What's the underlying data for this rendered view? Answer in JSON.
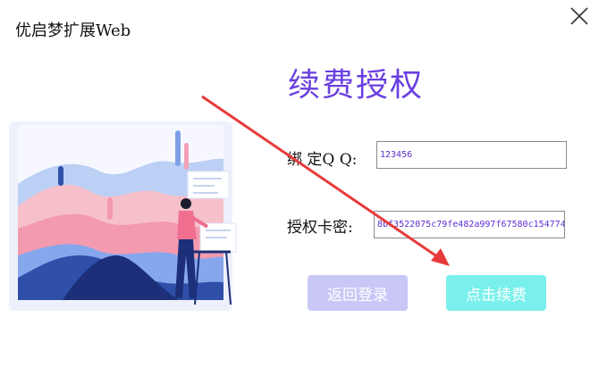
{
  "window": {
    "title": "优启梦扩展Web"
  },
  "form": {
    "heading": "续费授权",
    "qq_label": "绑 定Q Q:",
    "qq_value": "123456",
    "key_label": "授权卡密:",
    "key_value": "8bf3522075c79fe482a997f67580c154774"
  },
  "buttons": {
    "back_label": "返回登录",
    "renew_label": "点击续费"
  },
  "colors": {
    "heading": "#6a3fe0",
    "back_button": "#c9c7f6",
    "renew_button": "#7af0ec",
    "arrow": "#e83a3a"
  },
  "icons": {
    "close": "close-icon"
  }
}
